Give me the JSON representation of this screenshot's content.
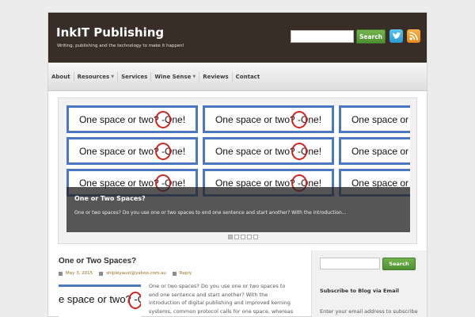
{
  "header": {
    "title": "InkIT Publishing",
    "tagline": "Writing, publishing and the technology to make it happen!",
    "search_button": "Search",
    "search_placeholder": ""
  },
  "nav": {
    "items": [
      {
        "label": "About"
      },
      {
        "label": "Resources"
      },
      {
        "label": "Services"
      },
      {
        "label": "Wine Sense"
      },
      {
        "label": "Reviews"
      },
      {
        "label": "Contact"
      }
    ]
  },
  "slider": {
    "tile_text": "One space or two? -One!",
    "tile_text_cut": "One spa",
    "caption_title": "One or Two Spaces?",
    "caption_text": "One or two spaces? Do you use one or two spaces to end one sentence and start another? With the introduction..."
  },
  "post": {
    "title": "One or Two Spaces?",
    "date": "May 3, 2015",
    "author": "shipleyaust@yahoo.com.au",
    "reply": "Reply",
    "thumb_text": "e space or two? -O",
    "body": "One or two spaces? Do you use one or two spaces to end one sentence and start another? With the introduction of digital publishing and improved kerning systems, common protocol calls for one space, whereas"
  },
  "sidebar": {
    "search_button": "Search",
    "subscribe_title": "Subscribe to Blog via Email",
    "subscribe_text": "Enter your email address to subscribe"
  },
  "colors": {
    "header_bg": "#382d27",
    "button_green": "#5a9e3a",
    "tile_border": "#4b78c0",
    "circle_red": "#d0231f"
  }
}
